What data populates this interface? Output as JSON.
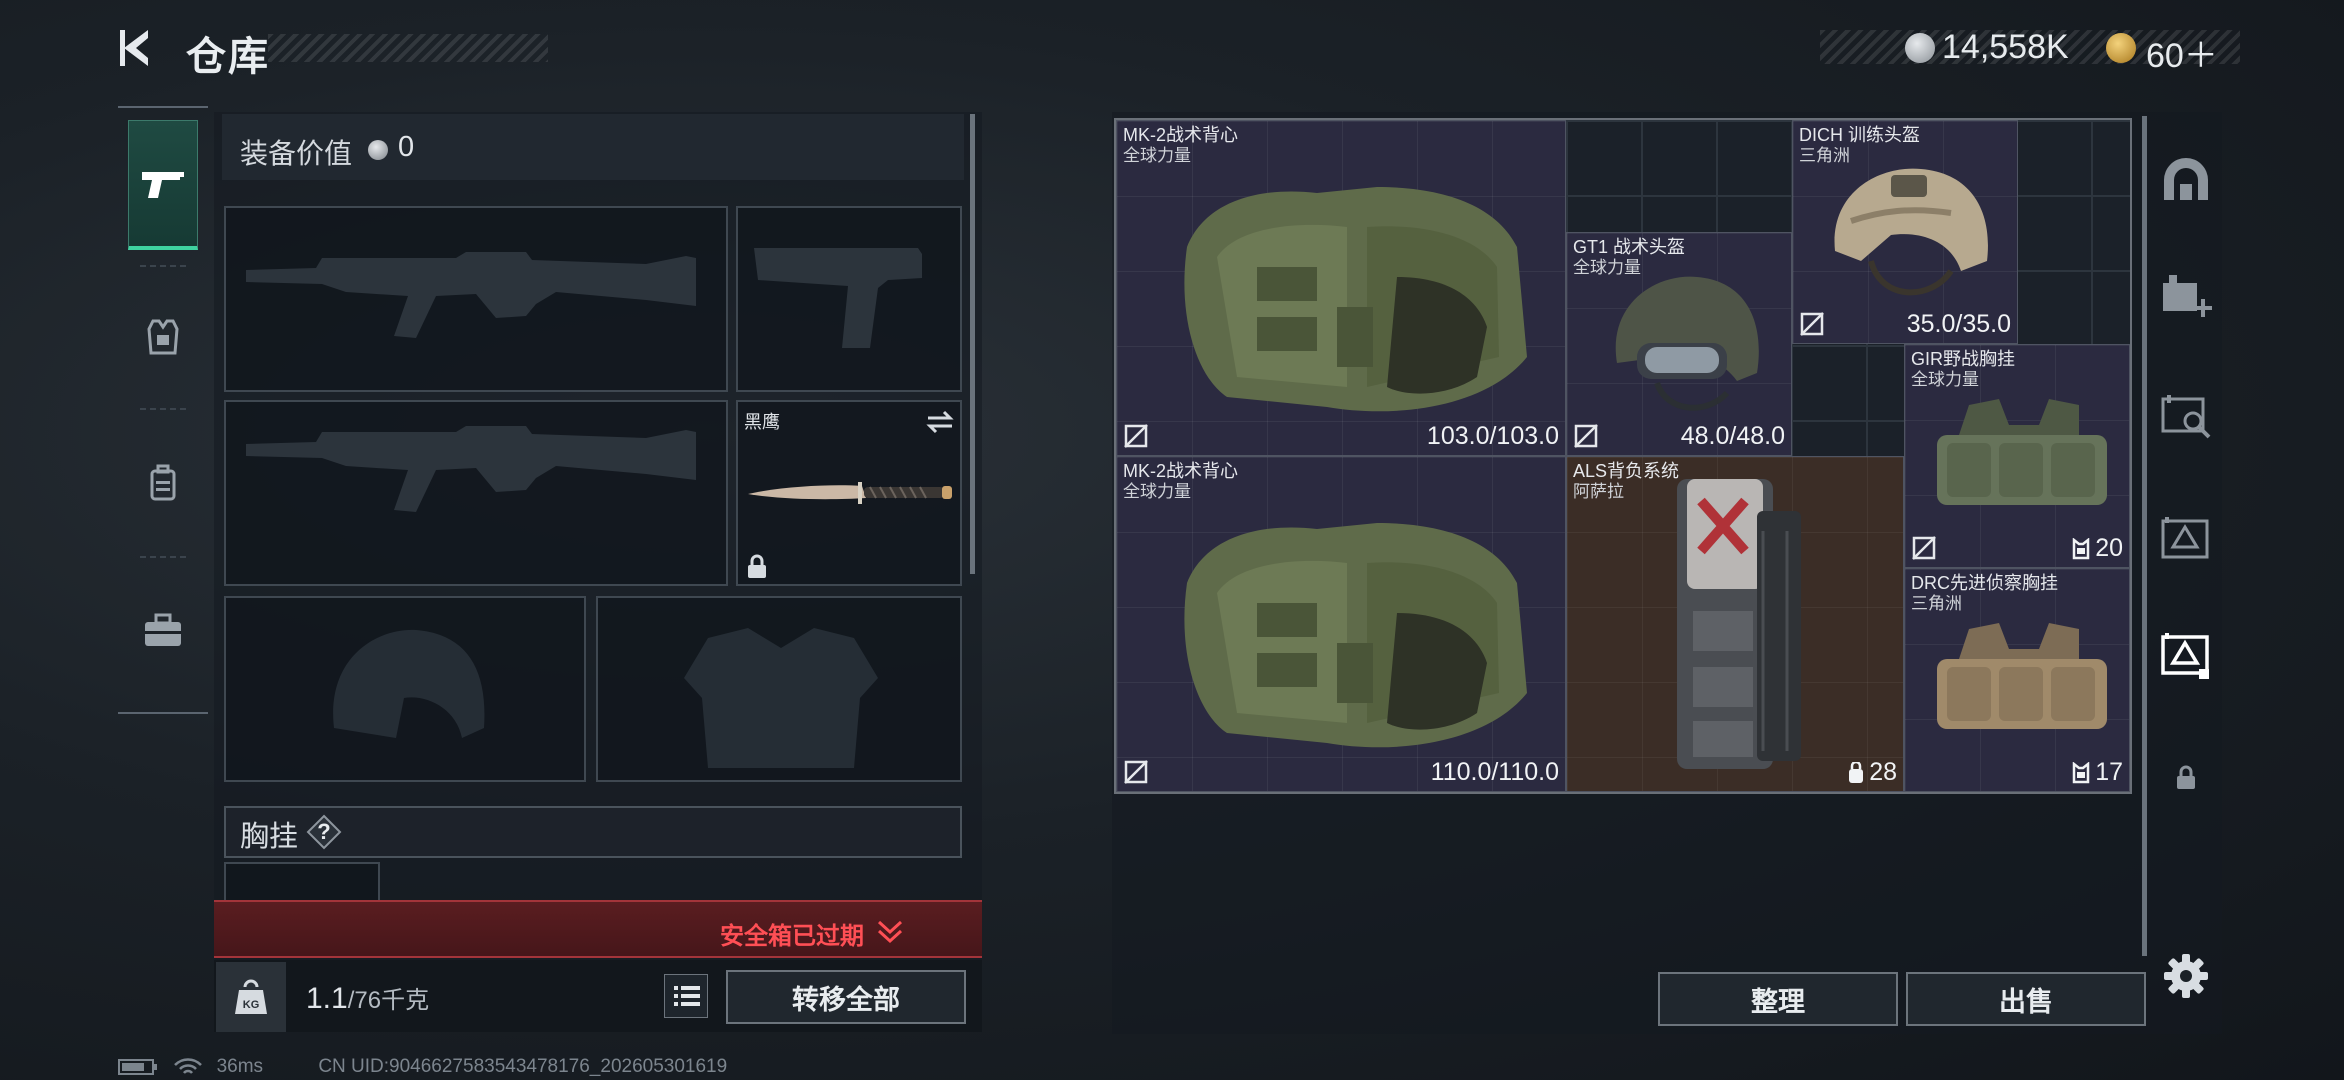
{
  "header": {
    "title": "仓库"
  },
  "currency": {
    "silver": "14,558K",
    "gold": "60＋"
  },
  "equip": {
    "value_label": "装备价值",
    "value": "0",
    "knife_label": "黑鹰",
    "chest_rig_label": "胸挂",
    "chest_rig_help": "?"
  },
  "safe_box": {
    "expired_text": "安全箱已过期"
  },
  "weight": {
    "current": "1.1",
    "max": "/76千克"
  },
  "buttons": {
    "transfer_all": "转移全部",
    "sort": "整理",
    "sell": "出售"
  },
  "items": [
    {
      "name": "MK-2战术背心",
      "sub": "全球力量",
      "value": "103.0/103.0",
      "type": "vest",
      "rarity": "purple"
    },
    {
      "name": "GT1 战术头盔",
      "sub": "全球力量",
      "value": "48.0/48.0",
      "type": "helmet",
      "rarity": "purple"
    },
    {
      "name": "DICH 训练头盔",
      "sub": "三角洲",
      "value": "35.0/35.0",
      "type": "helmet",
      "rarity": "purple"
    },
    {
      "name": "GIR野战胸挂",
      "sub": "全球力量",
      "value": "20",
      "type": "rig",
      "rarity": "purple"
    },
    {
      "name": "MK-2战术背心",
      "sub": "全球力量",
      "value": "110.0/110.0",
      "type": "vest",
      "rarity": "purple"
    },
    {
      "name": "ALS背负系统",
      "sub": "阿萨拉",
      "value": "28",
      "type": "backpack",
      "rarity": "brown"
    },
    {
      "name": "DRC先进侦察胸挂",
      "sub": "三角洲",
      "value": "17",
      "type": "rig",
      "rarity": "purple"
    }
  ],
  "status": {
    "ping": "36ms",
    "uid": "CN UID:9046627583543478176_202605301619"
  },
  "colors": {
    "accent_green": "#3fd3a0",
    "expired_red": "#ff4f55",
    "rarity_purple": "#2b2a40",
    "rarity_brown": "#3b2d26"
  }
}
